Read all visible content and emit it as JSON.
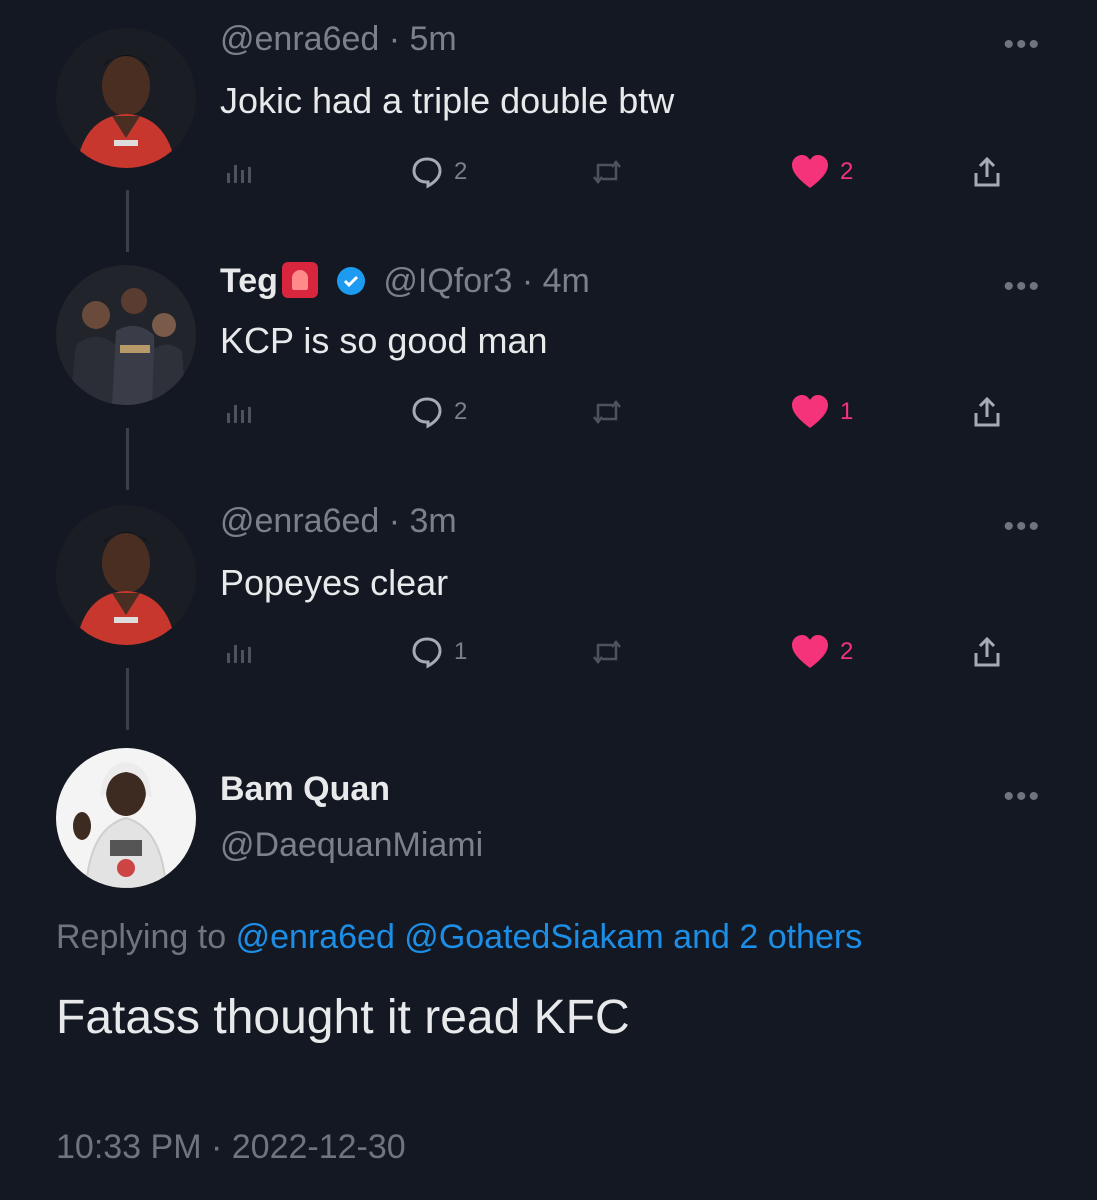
{
  "colors": {
    "background": "#141822",
    "text": "#e7e9ea",
    "muted": "#7a818a",
    "like": "#f5337a",
    "link": "#1d8ee6"
  },
  "tweets": [
    {
      "handle_time": "@enra6ed · 5m",
      "text": "Jokic had a triple double btw",
      "replies": "2",
      "likes": "2"
    },
    {
      "name": "Teg",
      "handle_time": "@IQfor3 · 4m",
      "text": "KCP is so good man",
      "replies": "2",
      "likes": "1",
      "verified": true,
      "emoji_icon": "siren-emoji-icon"
    },
    {
      "handle_time": "@enra6ed · 3m",
      "text": "Popeyes clear",
      "replies": "1",
      "likes": "2"
    }
  ],
  "main_tweet": {
    "name": "Bam Quan",
    "handle": "@DaequanMiami",
    "replying_prefix": "Replying to",
    "replying_targets": "@enra6ed @GoatedSiakam and 2 others",
    "text": "Fatass thought it read KFC",
    "timestamp": "10:33 PM · 2022-12-30"
  },
  "more_icon": "•••"
}
